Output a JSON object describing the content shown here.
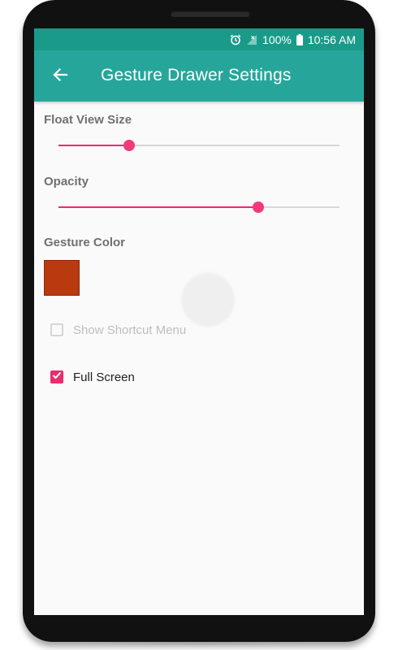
{
  "status_bar": {
    "battery": "100%",
    "time": "10:56 AM",
    "icons": [
      "alarm-icon",
      "no-signal-icon",
      "battery-icon"
    ]
  },
  "app_bar": {
    "title": "Gesture Drawer Settings",
    "back_icon": "arrow-left-icon"
  },
  "settings": {
    "float_view_size": {
      "label": "Float View Size",
      "value_fraction": 0.25
    },
    "opacity": {
      "label": "Opacity",
      "value_fraction": 0.71
    },
    "gesture_color": {
      "label": "Gesture Color",
      "color": "#b83a0e"
    },
    "show_shortcut_menu": {
      "label": "Show Shortcut Menu",
      "checked": false,
      "enabled": false
    },
    "full_screen": {
      "label": "Full Screen",
      "checked": true,
      "enabled": true
    }
  },
  "colors": {
    "status_bar": "#1a9b8a",
    "app_bar": "#26a69a",
    "accent": "#ec2a6e",
    "background": "#fafafa"
  }
}
